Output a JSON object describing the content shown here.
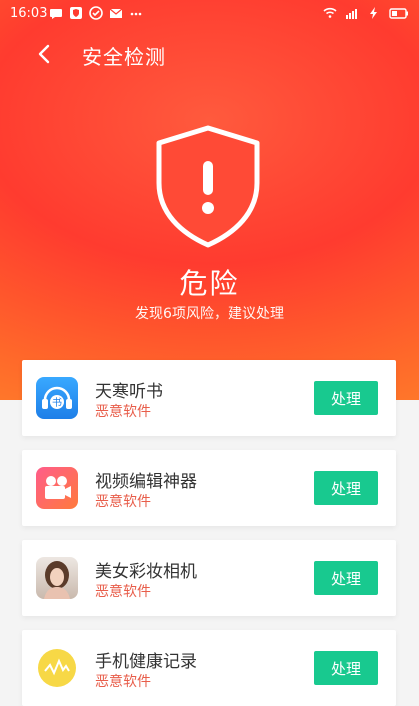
{
  "status_bar": {
    "time": "16:03",
    "left_icons": [
      "chat-bubble-icon",
      "shield-badge-icon",
      "check-circle-icon",
      "mail-icon",
      "more-dots-icon"
    ],
    "right_icons": [
      "wifi-icon",
      "signal-icon",
      "charging-icon",
      "battery-icon"
    ]
  },
  "header": {
    "back_label": "<",
    "title": "安全检测"
  },
  "hero": {
    "status": "危险",
    "subtitle": "发现6项风险，建议处理"
  },
  "items": [
    {
      "name": "天寒听书",
      "tag": "恶意软件",
      "action": "处理",
      "icon": "book-headphones-icon"
    },
    {
      "name": "视频编辑神器",
      "tag": "恶意软件",
      "action": "处理",
      "icon": "video-camera-icon"
    },
    {
      "name": "美女彩妆相机",
      "tag": "恶意软件",
      "action": "处理",
      "icon": "portrait-photo-icon"
    },
    {
      "name": "手机健康记录",
      "tag": "恶意软件",
      "action": "处理",
      "icon": "health-record-icon"
    }
  ],
  "colors": {
    "danger_bg": "#ff3b2f",
    "action_green": "#18c98f",
    "tag_red": "#e85d4a"
  }
}
